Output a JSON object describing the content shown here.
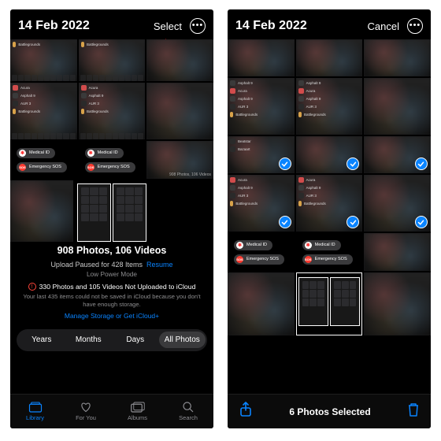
{
  "left": {
    "date": "14 Feb 2022",
    "select_label": "Select",
    "thumbs": {
      "apps": [
        {
          "label": "Battlegrounds",
          "icon": "#d8a24a"
        },
        {
          "label": "Acura",
          "icon": "#d14c4c"
        },
        {
          "label": "Asphalt 9",
          "icon": "#3a3a3a"
        },
        {
          "label": "AUR 3",
          "icon": "#2a2a2a"
        },
        {
          "label": "Battlegrounds",
          "icon": "#d8a24a"
        }
      ],
      "medical": {
        "label": "Medical ID",
        "sos": "Emergency SOS"
      },
      "caption_tiny": "908 Photos, 106 Videos"
    },
    "info": {
      "title": "908 Photos, 106 Videos",
      "paused": "Upload Paused for 428 Items",
      "resume": "Resume",
      "low_power": "Low Power Mode",
      "warn": "330 Photos and 105 Videos Not Uploaded to iCloud",
      "detail": "Your last 435 items could not be saved in iCloud because you don't have enough storage.",
      "manage": "Manage Storage or Get iCloud+"
    },
    "seg": {
      "years": "Years",
      "months": "Months",
      "days": "Days",
      "all": "All Photos"
    },
    "tabs": {
      "library": "Library",
      "foryou": "For You",
      "albums": "Albums",
      "search": "Search"
    }
  },
  "right": {
    "date": "14 Feb 2022",
    "cancel_label": "Cancel",
    "selected_count": "6 Photos Selected",
    "thumbs_apps": [
      {
        "label": "Asphalt 9",
        "icon": "#3a3a3a"
      },
      {
        "label": "Acura",
        "icon": "#d14c4c"
      },
      {
        "label": "Asphalt 9",
        "icon": "#3a3a3a"
      },
      {
        "label": "AUR 3",
        "icon": "#2a2a2a"
      },
      {
        "label": "Battlegrounds",
        "icon": "#d8a24a"
      },
      {
        "label": "Beatstar",
        "icon": "#2a2a2a"
      },
      {
        "label": "Bazaart",
        "icon": "#2a2a2a"
      },
      {
        "label": "AUR 3",
        "icon": "#2a2a2a"
      }
    ],
    "medical": {
      "label": "Medical ID",
      "sos": "Emergency SOS"
    }
  }
}
